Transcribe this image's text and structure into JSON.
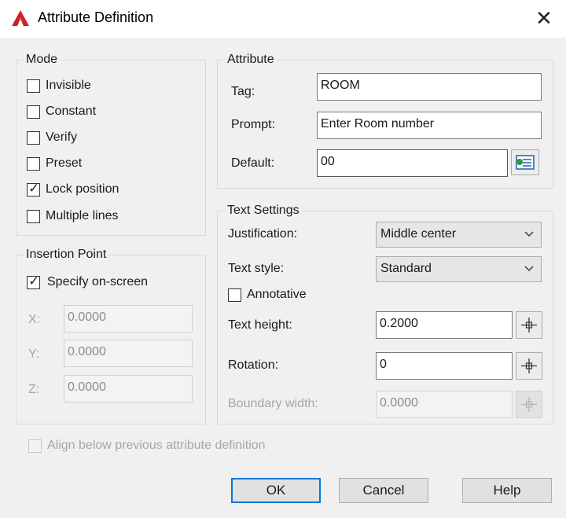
{
  "window": {
    "title": "Attribute Definition"
  },
  "mode": {
    "label": "Mode",
    "options": [
      {
        "label": "Invisible",
        "checked": false
      },
      {
        "label": "Constant",
        "checked": false
      },
      {
        "label": "Verify",
        "checked": false
      },
      {
        "label": "Preset",
        "checked": false
      },
      {
        "label": "Lock position",
        "checked": true
      },
      {
        "label": "Multiple lines",
        "checked": false
      }
    ]
  },
  "attribute": {
    "label": "Attribute",
    "tag": {
      "label": "Tag:",
      "value": "ROOM"
    },
    "prompt": {
      "label": "Prompt:",
      "value": "Enter Room number"
    },
    "default": {
      "label": "Default:",
      "value": "00"
    }
  },
  "insertion_point": {
    "label": "Insertion Point",
    "specify_on_screen": {
      "label": "Specify on-screen",
      "checked": true
    },
    "x": {
      "label": "X:",
      "value": "0.0000"
    },
    "y": {
      "label": "Y:",
      "value": "0.0000"
    },
    "z": {
      "label": "Z:",
      "value": "0.0000"
    }
  },
  "text_settings": {
    "label": "Text Settings",
    "justification": {
      "label": "Justification:",
      "value": "Middle center"
    },
    "text_style": {
      "label": "Text style:",
      "value": "Standard"
    },
    "annotative": {
      "label": "Annotative",
      "checked": false
    },
    "text_height": {
      "label": "Text height:",
      "value": "0.2000"
    },
    "rotation": {
      "label": "Rotation:",
      "value": "0"
    },
    "boundary_width": {
      "label": "Boundary width:",
      "value": "0.0000"
    }
  },
  "align_below": {
    "label": "Align below previous attribute definition",
    "checked": false
  },
  "buttons": {
    "ok": "OK",
    "cancel": "Cancel",
    "help": "Help"
  },
  "icons": {
    "app": "autocad-logo-icon",
    "close": "close-icon",
    "insert_field": "insert-field-icon",
    "pick": "crosshair-pick-icon"
  },
  "colors": {
    "accent": "#0078d7",
    "logo": "#d21f26"
  }
}
